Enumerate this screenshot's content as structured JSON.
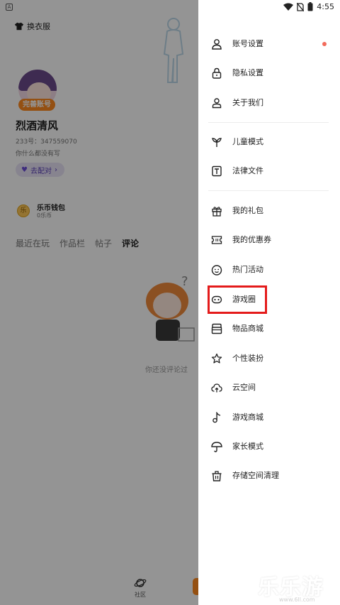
{
  "status_bar": {
    "time": "4:55"
  },
  "background": {
    "outfit_button": "换衣服",
    "complete_badge": "完善账号",
    "username": "烈酒清风",
    "user_id": "233号：347559070",
    "bio": "你什么都没有写",
    "match_button": "去配对",
    "wallet": {
      "coin_label": "乐",
      "title": "乐币钱包",
      "subtitle": "0乐币"
    },
    "tabs": [
      {
        "label": "最近在玩"
      },
      {
        "label": "作品栏"
      },
      {
        "label": "帖子"
      },
      {
        "label": "评论",
        "active": true
      }
    ],
    "empty_text": "你还没评论过",
    "bottom_nav": [
      {
        "label": "社区",
        "icon": "planet-icon"
      }
    ]
  },
  "drawer": {
    "items": [
      {
        "label": "账号设置",
        "icon": "person-icon",
        "badge": true
      },
      {
        "label": "隐私设置",
        "icon": "lock-icon"
      },
      {
        "label": "关于我们",
        "icon": "people-icon"
      },
      {
        "label": "儿童模式",
        "icon": "sprout-icon"
      },
      {
        "label": "法律文件",
        "icon": "document-t-icon"
      },
      {
        "label": "我的礼包",
        "icon": "gift-icon"
      },
      {
        "label": "我的优惠券",
        "icon": "coupon-icon"
      },
      {
        "label": "热门活动",
        "icon": "smiley-icon"
      },
      {
        "label": "游戏圈",
        "icon": "gamepad-icon",
        "highlighted": true
      },
      {
        "label": "物品商城",
        "icon": "store-icon"
      },
      {
        "label": "个性装扮",
        "icon": "star-outline-icon"
      },
      {
        "label": "云空间",
        "icon": "cloud-upload-icon"
      },
      {
        "label": "游戏商城",
        "icon": "music-note-icon"
      },
      {
        "label": "家长模式",
        "icon": "umbrella-icon"
      },
      {
        "label": "存储空间清理",
        "icon": "trash-icon"
      }
    ],
    "highlight_color": "#e41b1b"
  },
  "watermark": {
    "text": "乐乐游戏",
    "url": "www.6ll.com"
  }
}
